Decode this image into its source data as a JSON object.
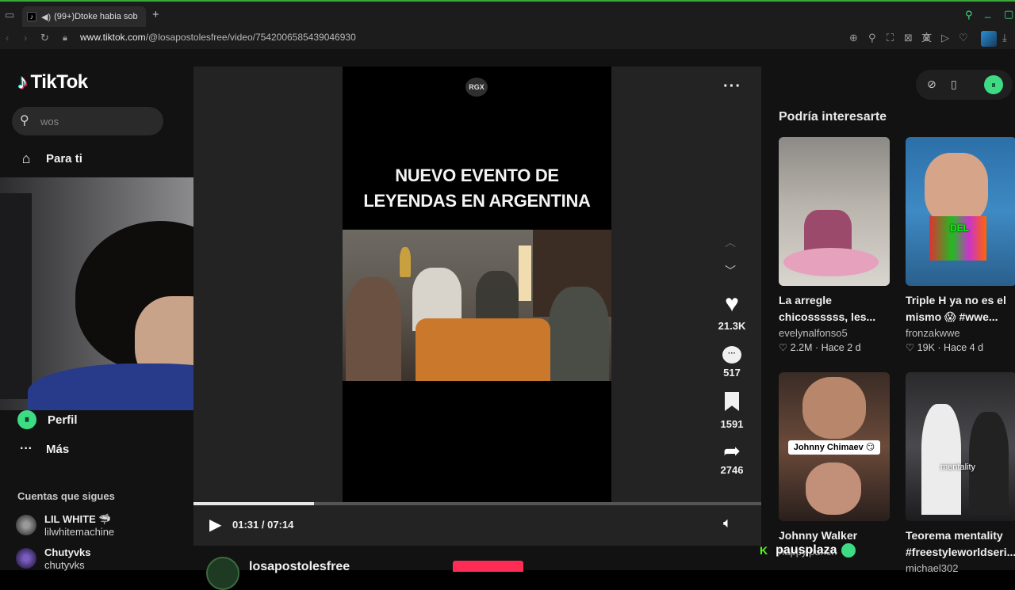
{
  "browser": {
    "tab_title": "(99+)Dtoke habia sob",
    "new_tab": "+",
    "url_domain": "www.tiktok.com",
    "url_path": "/@losapostolesfree/video/7542006585439046930"
  },
  "brand": {
    "name": "TikTok"
  },
  "search": {
    "value": "wos"
  },
  "nav": {
    "for_you": "Para ti",
    "profile": "Perfil",
    "more": "Más"
  },
  "following": {
    "title": "Cuentas que sigues",
    "accounts": [
      {
        "name": "LIL WHITE 🦈",
        "handle": "lilwhitemachine"
      },
      {
        "name": "Chutyvks",
        "handle": "chutyvks"
      }
    ]
  },
  "video": {
    "channel_badge": "RGX",
    "headline_line1": "NUEVO EVENTO DE",
    "headline_line2": "LEYENDAS EN ARGENTINA",
    "time": "01:31 / 07:14",
    "progress": 0.212,
    "author": "losapostolesfree"
  },
  "actions": {
    "likes": "21.3K",
    "comments": "517",
    "saves": "1591",
    "shares": "2746"
  },
  "recommendations": {
    "title": "Podría interesarte",
    "items": [
      {
        "title": "La arregle chicossssss, les...",
        "author": "evelynalfonso5",
        "meta": "♡ 2.2M · Hace 2 d"
      },
      {
        "title": "Triple H ya no es el mismo 😱 #wwe...",
        "author": "fronzakwwe",
        "meta": "♡ 19K · Hace 4 d",
        "thumb_text": "DEL"
      },
      {
        "title": "Johnny Walker",
        "author": "happy.punch",
        "meta": "",
        "thumb_text": "Johnny Chimaev 😏"
      },
      {
        "title": "Teorema mentality #freestyleworldseri...",
        "author": "michael302",
        "meta": "",
        "thumb_text": "mentality"
      }
    ]
  },
  "stream_overlay": {
    "handle": "pausplaza"
  },
  "colors": {
    "accent": "#3ddc84",
    "like": "#ffffff",
    "brand_pink": "#fe2c55"
  }
}
